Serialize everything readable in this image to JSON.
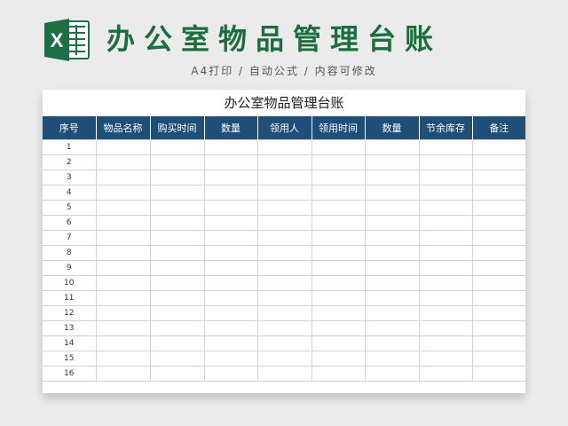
{
  "header": {
    "logo_letter": "X",
    "title": "办公室物品管理台账",
    "subtitle": "A4打印 / 自动公式 / 内容可修改"
  },
  "sheet": {
    "title": "办公室物品管理台账",
    "columns": [
      "序号",
      "物品名称",
      "购买时间",
      "数量",
      "领用人",
      "领用时间",
      "数量",
      "节余库存",
      "备注"
    ],
    "rows": [
      "1",
      "2",
      "3",
      "4",
      "5",
      "6",
      "7",
      "8",
      "9",
      "10",
      "11",
      "12",
      "13",
      "14",
      "15",
      "16"
    ]
  },
  "colors": {
    "title_green": "#1b6e3e",
    "header_blue": "#1f4e79",
    "excel_green": "#1d7044"
  }
}
